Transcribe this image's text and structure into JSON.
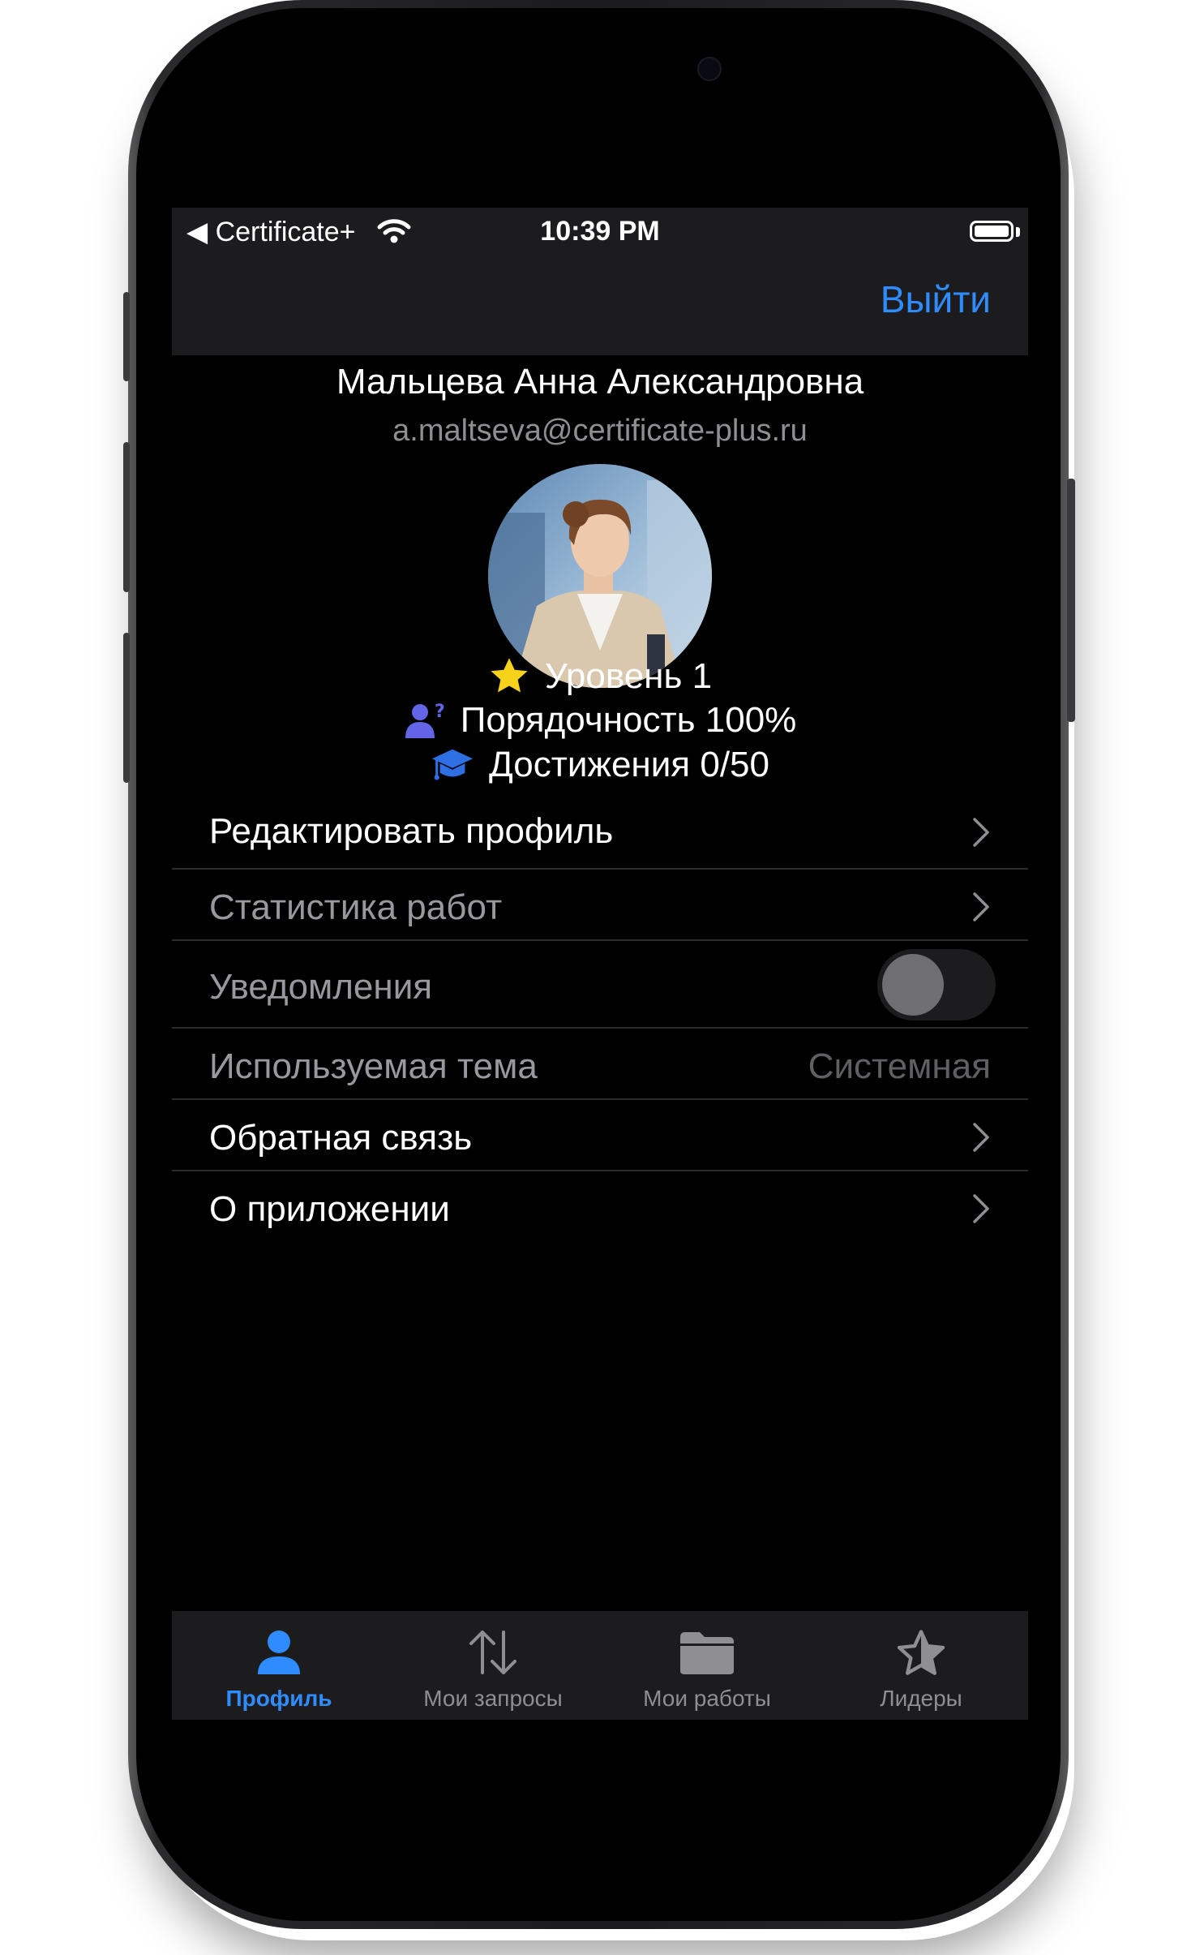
{
  "status_bar": {
    "back_app": "◀ Certificate+",
    "time": "10:39 PM"
  },
  "nav": {
    "logout_label": "Выйти",
    "accent_color": "#2f8cff"
  },
  "profile": {
    "name": "Мальцева Анна Александровна",
    "email": "a.maltseva@certificate-plus.ru",
    "avatar": "woman-in-beige-blazer-photo"
  },
  "stats": [
    {
      "icon": "star-icon",
      "label": "Уровень 1"
    },
    {
      "icon": "person-question-icon",
      "label": "Порядочность 100%"
    },
    {
      "icon": "graduation-cap-icon",
      "label": "Достижения 0/50"
    }
  ],
  "settings": {
    "edit_profile": "Редактировать профиль",
    "work_stats": "Статистика работ",
    "notifications": {
      "label": "Уведомления",
      "enabled": false
    },
    "theme": {
      "label": "Используемая тема",
      "value": "Системная"
    },
    "feedback": "Обратная связь",
    "about": "О приложении"
  },
  "tabs": [
    {
      "label": "Профиль",
      "icon": "person-icon",
      "active": true
    },
    {
      "label": "Мои запросы",
      "icon": "arrows-up-down-icon",
      "active": false
    },
    {
      "label": "Мои работы",
      "icon": "folder-icon",
      "active": false
    },
    {
      "label": "Лидеры",
      "icon": "star-outline-icon",
      "active": false
    }
  ]
}
